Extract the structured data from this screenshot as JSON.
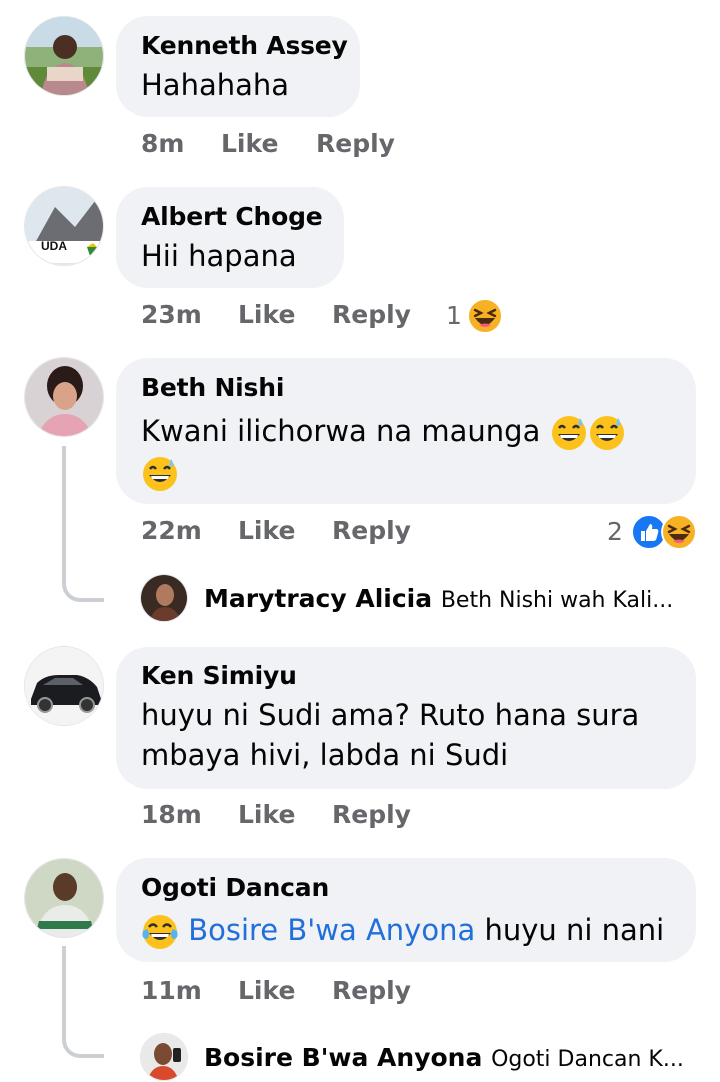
{
  "comments": [
    {
      "author": "Kenneth Assey",
      "text": "Hahahaha",
      "time": "8m",
      "like": "Like",
      "reply": "Reply"
    },
    {
      "author": "Albert Choge",
      "text": "Hii hapana",
      "time": "23m",
      "like": "Like",
      "reply": "Reply",
      "reaction_count": "1",
      "avatar_logo_text": "UDA"
    },
    {
      "author": "Beth Nishi",
      "text_line1": "Kwani ilichorwa na maunga",
      "time": "22m",
      "like": "Like",
      "reply": "Reply",
      "reaction_count": "2",
      "replies": [
        {
          "author": "Marytracy Alicia",
          "preview": "Beth Nishi wah Kali..."
        }
      ]
    },
    {
      "author": "Ken Simiyu",
      "text_line1": "huyu ni Sudi ama? Ruto hana sura",
      "text_line2": "mbaya hivi, labda ni Sudi",
      "time": "18m",
      "like": "Like",
      "reply": "Reply"
    },
    {
      "author": "Ogoti Dancan",
      "mention": "Bosire B'wa Anyona",
      "text_after": "huyu ni nani",
      "time": "11m",
      "like": "Like",
      "reply": "Reply",
      "replies": [
        {
          "author": "Bosire B'wa Anyona",
          "preview": "Ogoti Dancan K..."
        }
      ]
    }
  ],
  "colors": {
    "bubble": "#f0f2f5",
    "meta_text": "#65676b",
    "mention": "#216fdb",
    "like_reaction": "#1877f2",
    "haha_reaction": "#f7b125"
  },
  "icons": [
    "grinning-sweat-emoji",
    "laughing-squint-emoji",
    "tears-of-joy-emoji",
    "like-reaction-icon"
  ]
}
